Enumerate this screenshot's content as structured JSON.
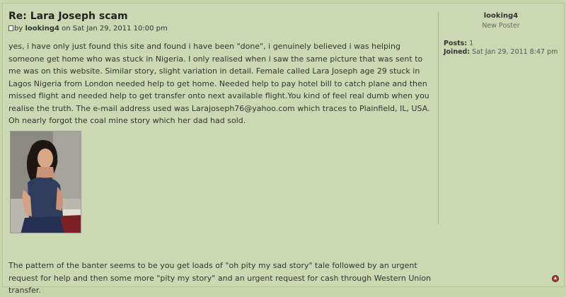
{
  "post": {
    "title": "Re: Lara Joseph scam",
    "by": "by",
    "author": "looking4",
    "date": "on Sat Jan 29, 2011 10:00 pm",
    "paragraph1": "yes, i have only just found this site and found i have been \"done\", i genuinely believed i was helping someone get home who was stuck in Nigeria. I only realised when i saw the same picture that was sent to me was on this website. Similar story, slight variation in detail. Female called Lara Joseph age 29 stuck in Lagos Nigeria from London needed help to get home. Needed help to pay hotel bill to catch plane and then missed flight and needed help to get transfer onto next available flight.You kind of feel real dumb when you realise the truth. The e-mail address used was Larajoseph76@yahoo.com which traces to Plainfield, IL, USA. Oh nearly forgot the coal mine story which her dad had sold.",
    "paragraph2": "The pattern of the banter seems to be you get loads of \"oh pity my sad story\" tale followed by an urgent request for help and then some more \"pity my story\" and an urgent request for cash through Western Union transfer."
  },
  "profile": {
    "username": "looking4",
    "rank": "New Poster",
    "posts_label": "Posts:",
    "posts_value": "1",
    "joined_label": "Joined:",
    "joined_value": "Sat Jan 29, 2011 8:47 pm"
  },
  "icons": {
    "post": "post-icon",
    "back_to_top": "back-to-top-icon"
  },
  "colors": {
    "background": "#c9d6ac",
    "panel": "#ccd8b2"
  }
}
